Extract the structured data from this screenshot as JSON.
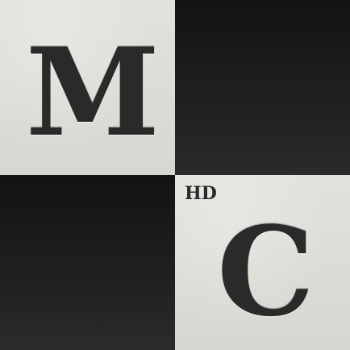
{
  "logo": {
    "letter_top_left": "M",
    "letter_bottom_right": "C",
    "badge": "HD"
  },
  "colors": {
    "light_tile": "#dcdad5",
    "dark_tile": "#1c1c1c",
    "letter": "#2a2a2a"
  }
}
